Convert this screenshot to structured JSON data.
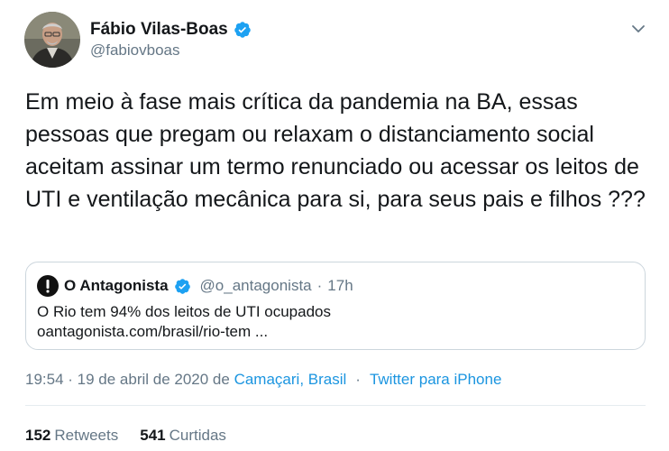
{
  "author": {
    "display_name": "Fábio Vilas-Boas",
    "handle": "@fabiovboas",
    "verified_icon": "verified-badge-icon",
    "avatar": "author-avatar"
  },
  "tweet": {
    "text": "Em meio à fase mais crítica da pandemia na BA, essas pessoas que pregam ou relaxam o distanciamento social aceitam assinar um termo renunciado ou acessar os leitos de UTI e ventilação mecânica para si, para seus pais e filhos ???"
  },
  "quoted": {
    "display_name": "O Antagonista",
    "handle": "@o_antagonista",
    "separator": "·",
    "time": "17h",
    "text": "O Rio tem 94% dos leitos de UTI ocupados",
    "link": "oantagonista.com/brasil/rio-tem ..."
  },
  "meta": {
    "time_date": "19:54 · 19 de abril de 2020 de ",
    "location": "Camaçari, Brasil",
    "separator": "·",
    "source": "Twitter para iPhone"
  },
  "stats": {
    "retweets_count": "152",
    "retweets_label": "Retweets",
    "likes_count": "541",
    "likes_label": "Curtidas"
  },
  "colors": {
    "accent": "#1da1f2",
    "link": "#1b95e0",
    "muted": "#657786",
    "text": "#14171a",
    "border": "#ccd6dd"
  }
}
